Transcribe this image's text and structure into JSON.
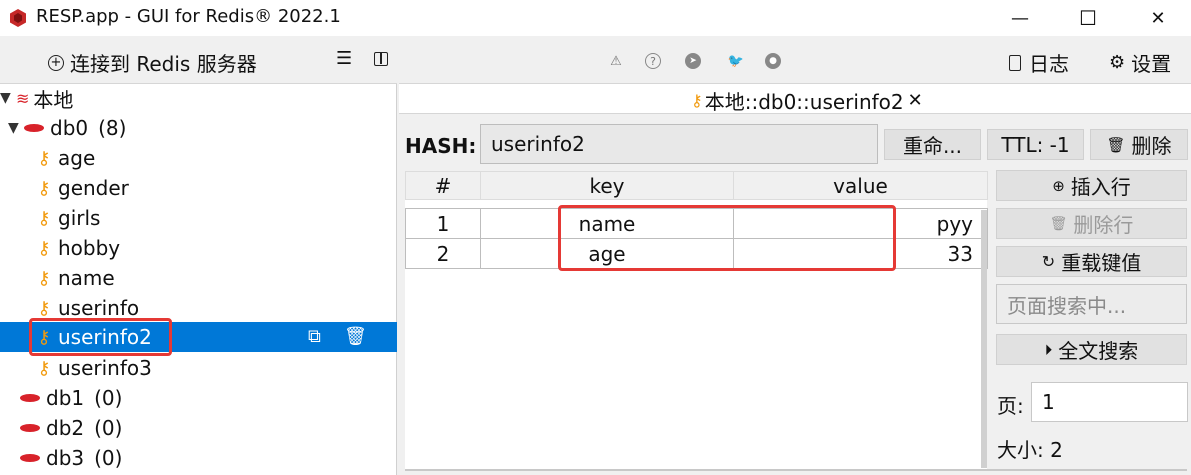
{
  "window": {
    "title": "RESP.app - GUI for Redis® 2022.1",
    "controls": {
      "minimize": "—",
      "maximize": "☐",
      "close": "✕"
    }
  },
  "left_panel": {
    "connect_label": "连接到 Redis 服务器",
    "connect_icon": "plus-circle-icon",
    "list_icon": "list-icon",
    "layout_icon": "panel-icon",
    "tree": {
      "server": "本地",
      "db0": {
        "name": "db0",
        "count": "(8)"
      },
      "keys": [
        "age",
        "gender",
        "girls",
        "hobby",
        "name",
        "userinfo",
        "userinfo2",
        "userinfo3"
      ],
      "selected_key": "userinfo2",
      "other_dbs": [
        {
          "name": "db1",
          "count": "(0)"
        },
        {
          "name": "db2",
          "count": "(0)"
        },
        {
          "name": "db3",
          "count": "(0)"
        }
      ]
    }
  },
  "toolbar": {
    "icons": [
      "warning-icon",
      "help-icon",
      "telegram-icon",
      "twitter-icon",
      "github-icon"
    ],
    "log_label": "日志",
    "settings_label": "设置"
  },
  "tab": {
    "label": "本地::db0::userinfo2",
    "close": "✕"
  },
  "key_view": {
    "type_label": "HASH:",
    "key_name": "userinfo2",
    "rename_label": "重命...",
    "ttl_label": "TTL:  -1",
    "delete_label": "删除",
    "columns": [
      "#",
      "key",
      "value"
    ],
    "rows": [
      {
        "index": "1",
        "key": "name",
        "value": "pyy"
      },
      {
        "index": "2",
        "key": "age",
        "value": "33"
      }
    ],
    "actions": {
      "insert_row": "插入行",
      "delete_row": "删除行",
      "reload": "重载键值",
      "search_placeholder": "页面搜索中...",
      "fulltext_search": "全文搜索",
      "page_label": "页:",
      "page_value": "1",
      "size_label": "大小: 2"
    }
  },
  "colors": {
    "selection": "#0078d7",
    "key_icon": "#f19a0e",
    "redis_red": "#d8222a",
    "highlight_box": "#e53935"
  }
}
